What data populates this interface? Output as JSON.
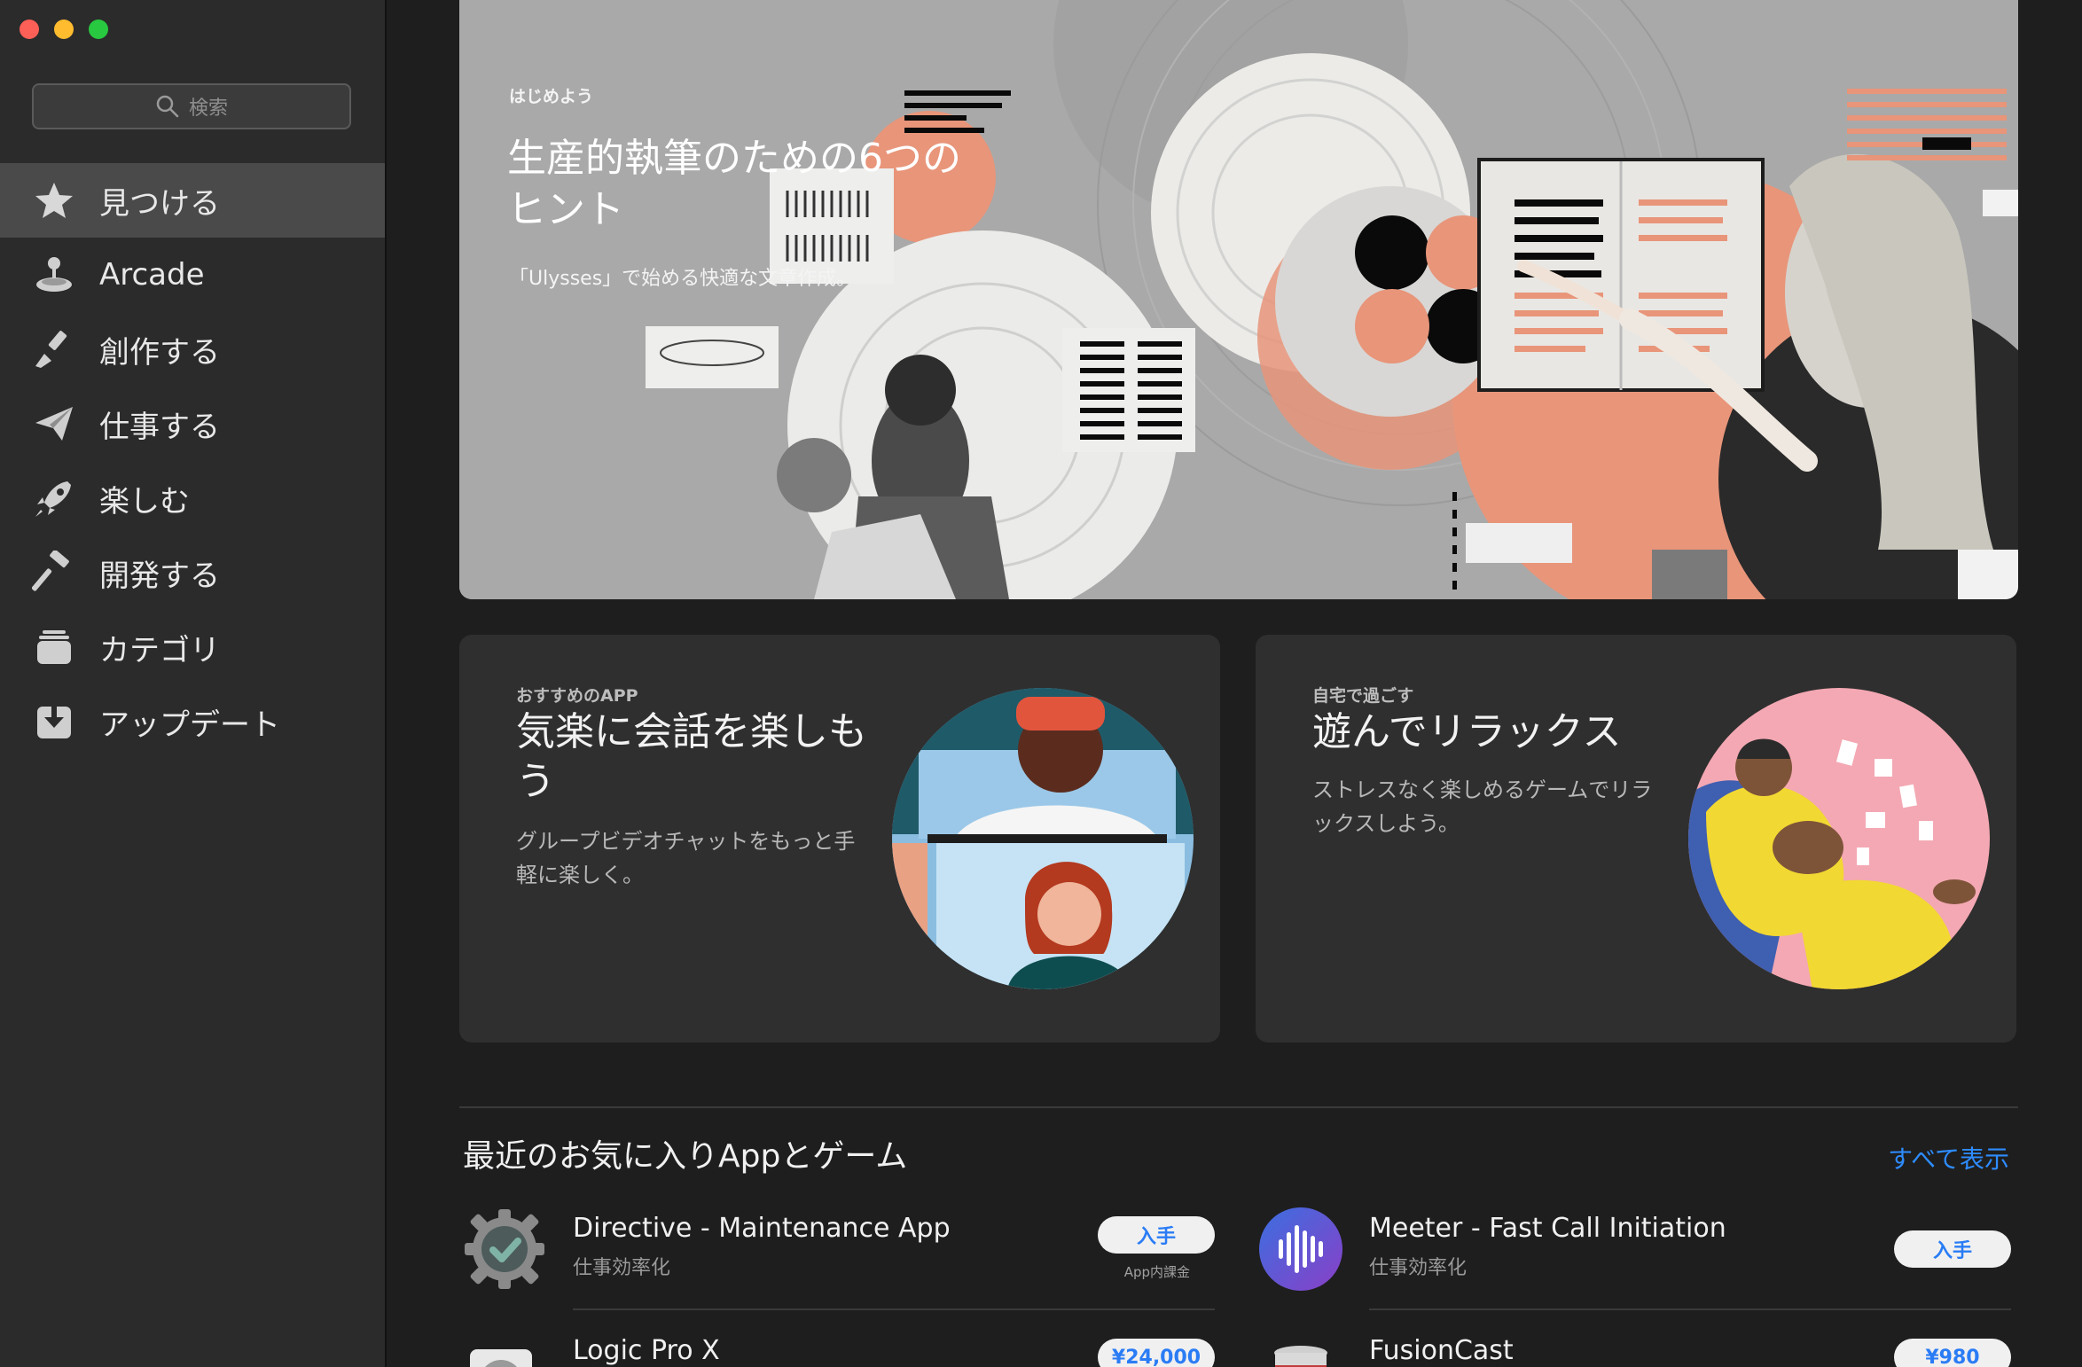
{
  "window": {
    "controls": [
      "close",
      "minimize",
      "maximize"
    ]
  },
  "search": {
    "placeholder": "検索",
    "icon": "search-icon"
  },
  "sidebar": {
    "items": [
      {
        "label": "見つける",
        "icon": "star-icon",
        "active": true
      },
      {
        "label": "Arcade",
        "icon": "joystick-icon",
        "active": false
      },
      {
        "label": "創作する",
        "icon": "brush-icon",
        "active": false
      },
      {
        "label": "仕事する",
        "icon": "paper-plane-icon",
        "active": false
      },
      {
        "label": "楽しむ",
        "icon": "rocket-icon",
        "active": false
      },
      {
        "label": "開発する",
        "icon": "hammer-icon",
        "active": false
      },
      {
        "label": "カテゴリ",
        "icon": "stack-icon",
        "active": false
      },
      {
        "label": "アップデート",
        "icon": "download-icon",
        "active": false
      }
    ]
  },
  "hero": {
    "eyebrow": "はじめよう",
    "title": "生産的執筆のための6つのヒント",
    "subtitle": "「Ulysses」で始める快適な文章作成。"
  },
  "cards": [
    {
      "eyebrow": "おすすめのAPP",
      "title": "気楽に会話を楽しもう",
      "description": "グループビデオチャットをもっと手軽に楽しく。"
    },
    {
      "eyebrow": "自宅で過ごす",
      "title": "遊んでリラックス",
      "description": "ストレスなく楽しめるゲームでリラックスしよう。"
    }
  ],
  "favorites": {
    "title": "最近のお気に入りAppとゲーム",
    "see_all": "すべて表示",
    "apps": [
      {
        "name": "Directive - Maintenance App",
        "category": "仕事効率化",
        "button": "入手",
        "note": "App内課金",
        "icon": "gear-check-icon"
      },
      {
        "name": "Meeter - Fast Call Initiation",
        "category": "仕事効率化",
        "button": "入手",
        "icon": "soundwave-icon"
      },
      {
        "name": "Logic Pro X",
        "category": "",
        "button": "¥24,000",
        "icon": "logic-pro-icon"
      },
      {
        "name": "FusionCast",
        "category": "",
        "button": "¥980",
        "icon": "fusioncast-icon"
      }
    ]
  },
  "colors": {
    "accent": "#2e8cff",
    "sidebar_bg": "#2b2b2b",
    "main_bg": "#1e1e1e",
    "card_bg": "#2f2f2f",
    "hero_salmon": "#e8957a"
  }
}
